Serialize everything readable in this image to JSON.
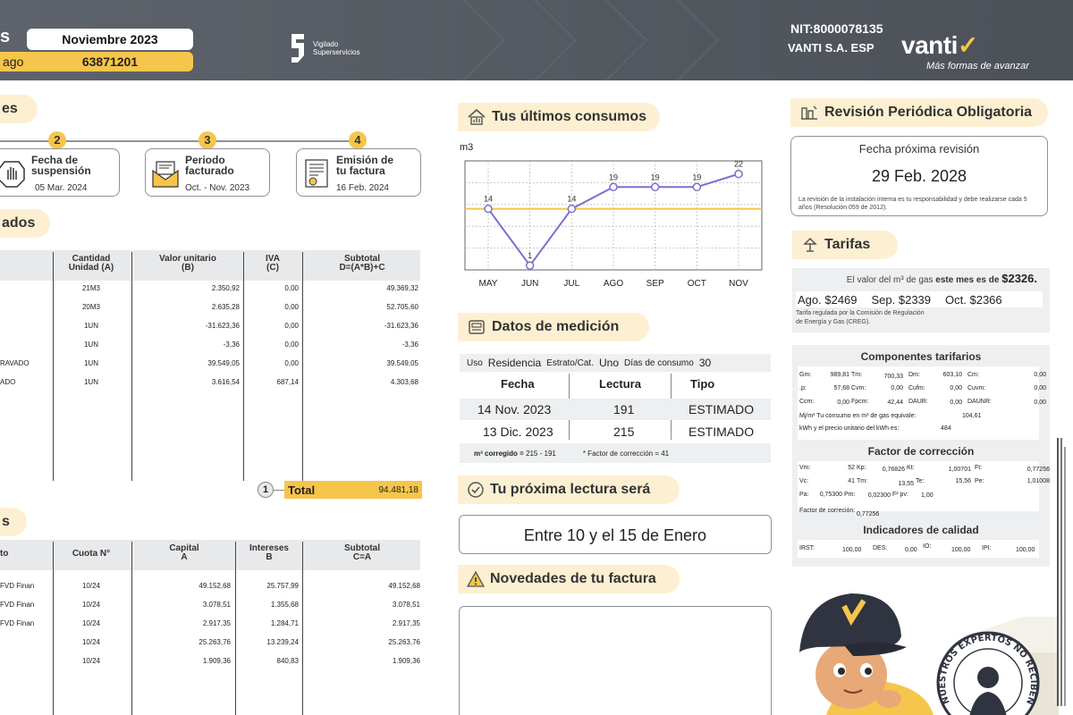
{
  "header": {
    "left_letter": "s",
    "period": "Noviembre 2023",
    "payment_label": "ago",
    "payment_ref": "63871201",
    "vigilado_line1": "Vigilado",
    "vigilado_line2": "Superservicios",
    "nit": "NIT:8000078135",
    "company": "VANTI S.A. ESP",
    "brand": "vanti",
    "slogan": "Más formas de avanzar"
  },
  "sections": {
    "fechas_tag": "es",
    "consumos_tag": "ados",
    "financ_tag": "s",
    "ultimos_consumos": "Tus últimos consumos",
    "datos_medicion": "Datos de medición",
    "proxima_lectura": "Tu próxima lectura será",
    "novedades": "Novedades de tu factura",
    "revision": "Revisión Periódica Obligatoria",
    "tarifas": "Tarifas"
  },
  "steps": [
    {
      "num": "2",
      "title1": "Fecha de",
      "title2": "suspensión",
      "value": "05 Mar. 2024",
      "icon": "hand-stop-icon"
    },
    {
      "num": "3",
      "title1": "Periodo",
      "title2": "facturado",
      "value": "Oct. - Nov. 2023",
      "icon": "envelope-icon"
    },
    {
      "num": "4",
      "title1": "Emisión de",
      "title2": "tu factura",
      "value": "16 Feb. 2024",
      "icon": "invoice-icon"
    }
  ],
  "consumos_table": {
    "headers": [
      {
        "l1": "Cantidad",
        "l2": "Unidad (A)"
      },
      {
        "l1": "Valor unitario",
        "l2": "(B)"
      },
      {
        "l1": "IVA",
        "l2": "(C)"
      },
      {
        "l1": "Subtotal",
        "l2": "D=(A*B)+C"
      }
    ],
    "rows": [
      {
        "desc": "",
        "qty": "21M3",
        "unit": "2.350,92",
        "iva": "0,00",
        "sub": "49.369,32"
      },
      {
        "desc": "",
        "qty": "20M3",
        "unit": "2.635,28",
        "iva": "0,00",
        "sub": "52.705,60"
      },
      {
        "desc": "",
        "qty": "1UN",
        "unit": "-31.623,36",
        "iva": "0,00",
        "sub": "-31.623,36"
      },
      {
        "desc": "",
        "qty": "1UN",
        "unit": "-3,36",
        "iva": "0,00",
        "sub": "-3,36"
      },
      {
        "desc": "RAVADO",
        "qty": "1UN",
        "unit": "39.549,05",
        "iva": "0,00",
        "sub": "39.549,05"
      },
      {
        "desc": "ADO",
        "qty": "1UN",
        "unit": "3.616,54",
        "iva": "687,14",
        "sub": "4.303,68"
      }
    ],
    "total_num": "1",
    "total_label": "Total",
    "total_value": "94.481,18"
  },
  "financ_table": {
    "headers": [
      {
        "l1": "to",
        "l2": ""
      },
      {
        "l1": "Cuota N°",
        "l2": ""
      },
      {
        "l1": "Capital",
        "l2": "A"
      },
      {
        "l1": "Intereses",
        "l2": "B"
      },
      {
        "l1": "Subtotal",
        "l2": "C=A"
      }
    ],
    "rows": [
      {
        "desc": "FVD Finan",
        "cuota": "10/24",
        "cap": "49.152,68",
        "int": "25.757,99",
        "sub": "49.152,68"
      },
      {
        "desc": "FVD Finan",
        "cuota": "10/24",
        "cap": "3.078,51",
        "int": "1.355,68",
        "sub": "3.078,51"
      },
      {
        "desc": "FVD Finan",
        "cuota": "10/24",
        "cap": "2.917,35",
        "int": "1.284,71",
        "sub": "2.917,35"
      },
      {
        "desc": "",
        "cuota": "10/24",
        "cap": "25.263,76",
        "int": "13.239,24",
        "sub": "25.263,76"
      },
      {
        "desc": "",
        "cuota": "10/24",
        "cap": "1.909,36",
        "int": "840,83",
        "sub": "1.909,36"
      }
    ]
  },
  "chart_data": {
    "type": "line",
    "ylabel": "m3",
    "categories": [
      "MAY",
      "JUN",
      "JUL",
      "AGO",
      "SEP",
      "OCT",
      "NOV"
    ],
    "values": [
      14,
      1,
      14,
      19,
      19,
      19,
      22
    ],
    "average_line": 14,
    "ylim": [
      0,
      25
    ],
    "grid": true,
    "colors": {
      "line": "#7b6fcf",
      "average": "#f6c54b",
      "marker": "#7b6fcf"
    }
  },
  "medicion": {
    "uso_label": "Uso",
    "uso_value": "Residencia",
    "estrato_label": "Estrato/Cat.",
    "estrato_value": "Uno",
    "dias_label": "Días de consumo",
    "dias_value": "30",
    "headers": [
      "Fecha",
      "Lectura",
      "Tipo"
    ],
    "rows": [
      {
        "fecha": "14 Nov. 2023",
        "lectura": "191",
        "tipo": "ESTIMADO"
      },
      {
        "fecha": "13 Dic. 2023",
        "lectura": "215",
        "tipo": "ESTIMADO"
      }
    ],
    "corregido_label": "m³ corregido =",
    "corregido_value": "215 - 191",
    "factor_label": "* Factor de corrección =",
    "factor_value": "41"
  },
  "proxima_lectura": "Entre 10 y el 15 de Enero",
  "revision": {
    "title": "Fecha próxima revisión",
    "date": "29 Feb. 2028",
    "note": "La revisión de la instalación interna es tu responsabilidad y debe realizarse cada 5 años (Resolución 059 de 2012)."
  },
  "tarifas": {
    "intro": "El valor del m³ de gas",
    "intro_bold": "este mes es de",
    "current": "$2326.",
    "prev": [
      "Ago. $2469",
      "Sep. $2339",
      "Oct. $2366"
    ],
    "note1": "Tarifa regulada por la Comisión de Regulación",
    "note2": "de Energía y Gas (CREG)."
  },
  "componentes": {
    "title": "Componentes tarifarios",
    "rows": [
      [
        "Gm:",
        "989,81",
        "Tm:",
        "700,33",
        "Dm:",
        "603,10",
        "Cm:",
        "0,00"
      ],
      [
        ".p:",
        "57,68",
        "Cvm:",
        "0,00",
        "Cufm:",
        "0,00",
        "Cuvm:",
        "0,00"
      ],
      [
        "Ccm:",
        "0,00",
        "Fpcm:",
        "42,44",
        "DAUR:",
        "0,00",
        "DAUNR:",
        "0,00"
      ]
    ],
    "equiv": "Mj/m³ Tu consumo en m³ de gas equivale:",
    "equiv_value": "104,61",
    "kwh": "kWh y el precio unitario del kWh es:",
    "kwh_value": "484"
  },
  "factor": {
    "title": "Factor de corrección",
    "rows": [
      [
        "Vm:",
        "52",
        "Kp:",
        "0,76826",
        "Kt:",
        "1,00701",
        "Ft:",
        "0,77256"
      ],
      [
        "Vc:",
        "41",
        "Tm:",
        "13,55",
        "Te:",
        "15,56",
        "Pe:",
        "1,01008"
      ],
      [
        "Pa:",
        "0,75300",
        "Pm:",
        "0,02300",
        "F² pv:",
        "1,00",
        "",
        ""
      ]
    ],
    "fc_label": "Factor de correción:",
    "fc_value": "0,77256"
  },
  "calidad": {
    "title": "Indicadores de calidad",
    "items": [
      "IRST:",
      "100,00",
      "DES:",
      "0,00",
      "IO:",
      "100,00",
      "IPI:",
      "100,00"
    ]
  },
  "stamp_text": "NUESTROS EXPERTOS NO RECIBEN DINERO"
}
